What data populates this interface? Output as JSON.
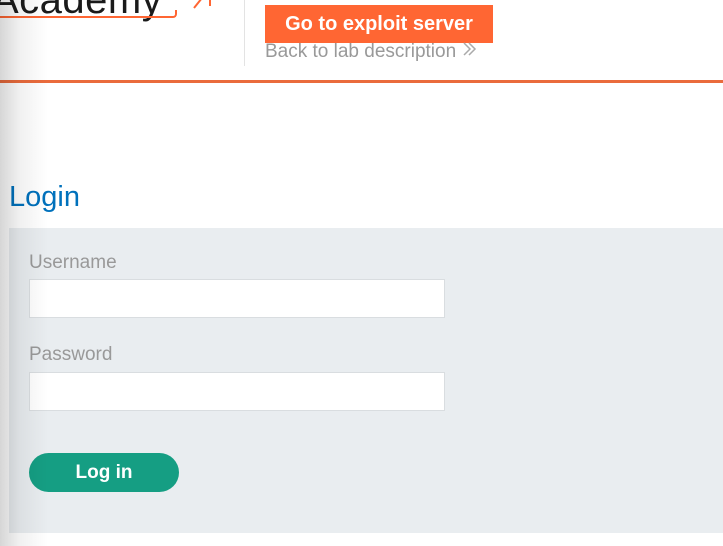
{
  "header": {
    "logo_text": "Academy",
    "exploit_button_label": "Go to exploit server",
    "back_link_label": "Back to lab description",
    "back_link_icon": "double-chevron-right-icon",
    "brand_color": "#ff6633"
  },
  "login": {
    "title": "Login",
    "username_label": "Username",
    "username_value": "",
    "password_label": "Password",
    "password_value": "",
    "submit_label": "Log in",
    "submit_color": "#159e83",
    "title_color": "#0071bc"
  }
}
